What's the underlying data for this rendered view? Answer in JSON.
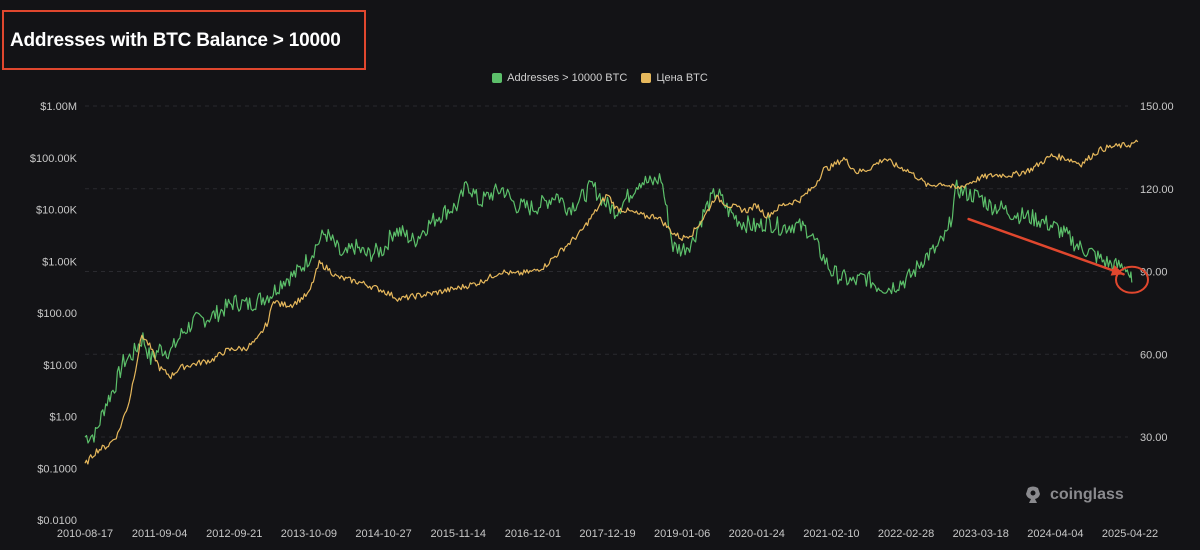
{
  "title": "Addresses with BTC Balance > 10000",
  "watermark": "coinglass",
  "colors": {
    "background": "#131316",
    "grid": "#2a2a2f",
    "series_addresses": "#5cbf6a",
    "series_price": "#e6b85c",
    "annotation": "#e0472e",
    "axis_text": "#c8c8c8"
  },
  "chart_data": {
    "type": "line",
    "title": "Addresses with BTC Balance > 10000",
    "legend_position": "top-center",
    "grid": true,
    "x_ticks": [
      "2010-08-17",
      "2011-09-04",
      "2012-09-21",
      "2013-10-09",
      "2014-10-27",
      "2015-11-14",
      "2016-12-01",
      "2017-12-19",
      "2019-01-06",
      "2020-01-24",
      "2021-02-10",
      "2022-02-28",
      "2023-03-18",
      "2024-04-04",
      "2025-04-22"
    ],
    "y_left": {
      "scale": "log",
      "range": [
        0.01,
        1000000
      ],
      "ticks": [
        {
          "value": 0.01,
          "label": "$0.0100"
        },
        {
          "value": 0.1,
          "label": "$0.1000"
        },
        {
          "value": 1,
          "label": "$1.00"
        },
        {
          "value": 10,
          "label": "$10.00"
        },
        {
          "value": 100,
          "label": "$100.00"
        },
        {
          "value": 1000,
          "label": "$1.00K"
        },
        {
          "value": 10000,
          "label": "$10.00K"
        },
        {
          "value": 100000,
          "label": "$100.00K"
        },
        {
          "value": 1000000,
          "label": "$1.00M"
        }
      ]
    },
    "y_right": {
      "scale": "linear",
      "range": [
        0,
        150
      ],
      "ticks": [
        {
          "value": 30,
          "label": "30.00"
        },
        {
          "value": 60,
          "label": "60.00"
        },
        {
          "value": 90,
          "label": "90.00"
        },
        {
          "value": 120,
          "label": "120.00"
        },
        {
          "value": 150,
          "label": "150.00"
        }
      ]
    },
    "series": [
      {
        "name": "Addresses > 10000 BTC",
        "axis": "right",
        "color": "#5cbf6a",
        "points": [
          [
            "2010-08-17",
            30
          ],
          [
            "2010-10-10",
            31
          ],
          [
            "2010-12-01",
            42
          ],
          [
            "2011-01-15",
            48
          ],
          [
            "2011-03-01",
            57
          ],
          [
            "2011-04-20",
            60
          ],
          [
            "2011-06-10",
            66
          ],
          [
            "2011-07-20",
            58
          ],
          [
            "2011-09-04",
            62
          ],
          [
            "2011-11-01",
            61
          ],
          [
            "2012-01-01",
            68
          ],
          [
            "2012-03-01",
            72
          ],
          [
            "2012-05-01",
            73
          ],
          [
            "2012-07-01",
            75
          ],
          [
            "2012-09-21",
            79
          ],
          [
            "2012-12-01",
            78
          ],
          [
            "2013-02-01",
            80
          ],
          [
            "2013-04-01",
            82
          ],
          [
            "2013-06-01",
            87
          ],
          [
            "2013-08-01",
            89
          ],
          [
            "2013-10-09",
            95
          ],
          [
            "2013-11-20",
            100
          ],
          [
            "2014-01-01",
            104
          ],
          [
            "2014-02-15",
            100
          ],
          [
            "2014-04-01",
            95
          ],
          [
            "2014-06-01",
            99
          ],
          [
            "2014-08-01",
            96
          ],
          [
            "2014-10-27",
            98
          ],
          [
            "2014-12-20",
            105
          ],
          [
            "2015-02-01",
            104
          ],
          [
            "2015-04-01",
            101
          ],
          [
            "2015-06-01",
            106
          ],
          [
            "2015-08-01",
            110
          ],
          [
            "2015-09-15",
            112
          ],
          [
            "2015-11-14",
            114
          ],
          [
            "2016-01-01",
            122
          ],
          [
            "2016-03-01",
            115
          ],
          [
            "2016-05-01",
            118
          ],
          [
            "2016-07-01",
            120
          ],
          [
            "2016-09-01",
            114
          ],
          [
            "2016-12-01",
            113
          ],
          [
            "2017-02-01",
            115
          ],
          [
            "2017-04-01",
            118
          ],
          [
            "2017-06-01",
            113
          ],
          [
            "2017-08-01",
            116
          ],
          [
            "2017-10-01",
            121
          ],
          [
            "2017-12-19",
            114
          ],
          [
            "2018-02-01",
            112
          ],
          [
            "2018-04-01",
            117
          ],
          [
            "2018-06-01",
            123
          ],
          [
            "2018-08-01",
            122
          ],
          [
            "2018-09-20",
            124
          ],
          [
            "2018-11-20",
            99
          ],
          [
            "2019-01-06",
            98
          ],
          [
            "2019-03-01",
            101
          ],
          [
            "2019-05-01",
            112
          ],
          [
            "2019-07-01",
            119
          ],
          [
            "2019-09-01",
            112
          ],
          [
            "2019-11-01",
            108
          ],
          [
            "2020-01-24",
            106
          ],
          [
            "2020-03-15",
            108
          ],
          [
            "2020-06-01",
            106
          ],
          [
            "2020-08-01",
            107
          ],
          [
            "2020-10-15",
            105
          ],
          [
            "2020-12-15",
            97
          ],
          [
            "2021-02-10",
            90
          ],
          [
            "2021-04-01",
            88
          ],
          [
            "2021-06-01",
            86
          ],
          [
            "2021-08-01",
            88
          ],
          [
            "2021-10-01",
            85
          ],
          [
            "2021-12-01",
            84
          ],
          [
            "2022-02-28",
            87
          ],
          [
            "2022-04-01",
            89
          ],
          [
            "2022-06-01",
            95
          ],
          [
            "2022-08-01",
            98
          ],
          [
            "2022-10-01",
            104
          ],
          [
            "2022-11-15",
            120
          ],
          [
            "2023-01-15",
            118
          ],
          [
            "2023-03-18",
            117
          ],
          [
            "2023-05-01",
            114
          ],
          [
            "2023-07-01",
            113
          ],
          [
            "2023-09-01",
            111
          ],
          [
            "2023-11-01",
            110
          ],
          [
            "2024-01-01",
            109
          ],
          [
            "2024-04-04",
            106
          ],
          [
            "2024-06-01",
            103
          ],
          [
            "2024-08-01",
            99
          ],
          [
            "2024-10-01",
            97
          ],
          [
            "2024-12-01",
            94
          ],
          [
            "2025-02-01",
            92
          ],
          [
            "2025-04-01",
            92
          ],
          [
            "2025-04-22",
            88
          ],
          [
            "2025-05-01",
            86
          ]
        ]
      },
      {
        "name": "Цена BTC",
        "axis": "right",
        "color": "#e6b85c",
        "points": [
          [
            "2010-08-17",
            20
          ],
          [
            "2010-10-15",
            25
          ],
          [
            "2010-12-15",
            27
          ],
          [
            "2011-02-01",
            31
          ],
          [
            "2011-04-01",
            43
          ],
          [
            "2011-06-05",
            67
          ],
          [
            "2011-07-15",
            63
          ],
          [
            "2011-09-04",
            55
          ],
          [
            "2011-11-01",
            52
          ],
          [
            "2011-12-15",
            55
          ],
          [
            "2012-02-01",
            56
          ],
          [
            "2012-04-01",
            57
          ],
          [
            "2012-06-01",
            58
          ],
          [
            "2012-08-01",
            61
          ],
          [
            "2012-09-21",
            62
          ],
          [
            "2012-11-15",
            62
          ],
          [
            "2013-01-15",
            65
          ],
          [
            "2013-03-15",
            72
          ],
          [
            "2013-04-10",
            80
          ],
          [
            "2013-05-15",
            78
          ],
          [
            "2013-07-15",
            78
          ],
          [
            "2013-10-09",
            82
          ],
          [
            "2013-12-01",
            93
          ],
          [
            "2014-01-15",
            91
          ],
          [
            "2014-03-01",
            88
          ],
          [
            "2014-05-01",
            87
          ],
          [
            "2014-07-01",
            86
          ],
          [
            "2014-10-27",
            83
          ],
          [
            "2015-01-15",
            80
          ],
          [
            "2015-04-01",
            81
          ],
          [
            "2015-07-01",
            82
          ],
          [
            "2015-11-14",
            84
          ],
          [
            "2016-03-01",
            86
          ],
          [
            "2016-06-20",
            90
          ],
          [
            "2016-09-01",
            89
          ],
          [
            "2016-12-01",
            90
          ],
          [
            "2017-02-01",
            92
          ],
          [
            "2017-05-01",
            98
          ],
          [
            "2017-08-01",
            104
          ],
          [
            "2017-10-01",
            110
          ],
          [
            "2017-12-19",
            118
          ],
          [
            "2018-02-01",
            113
          ],
          [
            "2018-04-01",
            112
          ],
          [
            "2018-07-01",
            110
          ],
          [
            "2018-09-01",
            110
          ],
          [
            "2018-11-20",
            104
          ],
          [
            "2019-01-06",
            102
          ],
          [
            "2019-03-01",
            104
          ],
          [
            "2019-05-01",
            110
          ],
          [
            "2019-06-25",
            117
          ],
          [
            "2019-09-01",
            114
          ],
          [
            "2019-12-01",
            112
          ],
          [
            "2020-01-24",
            114
          ],
          [
            "2020-03-15",
            110
          ],
          [
            "2020-06-01",
            114
          ],
          [
            "2020-09-01",
            116
          ],
          [
            "2020-11-15",
            121
          ],
          [
            "2021-01-01",
            127
          ],
          [
            "2021-02-10",
            128
          ],
          [
            "2021-04-15",
            131
          ],
          [
            "2021-06-20",
            126
          ],
          [
            "2021-08-15",
            127
          ],
          [
            "2021-11-10",
            131
          ],
          [
            "2022-01-15",
            128
          ],
          [
            "2022-02-28",
            127
          ],
          [
            "2022-05-01",
            124
          ],
          [
            "2022-06-20",
            121
          ],
          [
            "2022-09-01",
            122
          ],
          [
            "2022-11-15",
            120
          ],
          [
            "2023-01-15",
            122
          ],
          [
            "2023-03-18",
            124
          ],
          [
            "2023-06-01",
            125
          ],
          [
            "2023-09-01",
            125
          ],
          [
            "2023-12-01",
            127
          ],
          [
            "2024-03-15",
            132
          ],
          [
            "2024-06-01",
            131
          ],
          [
            "2024-08-15",
            129
          ],
          [
            "2024-11-15",
            134
          ],
          [
            "2025-01-01",
            135
          ],
          [
            "2025-04-22",
            136
          ],
          [
            "2025-06-01",
            137
          ]
        ]
      }
    ],
    "annotations": [
      {
        "type": "arrow",
        "from": [
          "2023-01-15",
          109
        ],
        "to": [
          "2025-03-20",
          89
        ]
      },
      {
        "type": "circle",
        "at": [
          "2025-04-22",
          87
        ]
      }
    ]
  }
}
